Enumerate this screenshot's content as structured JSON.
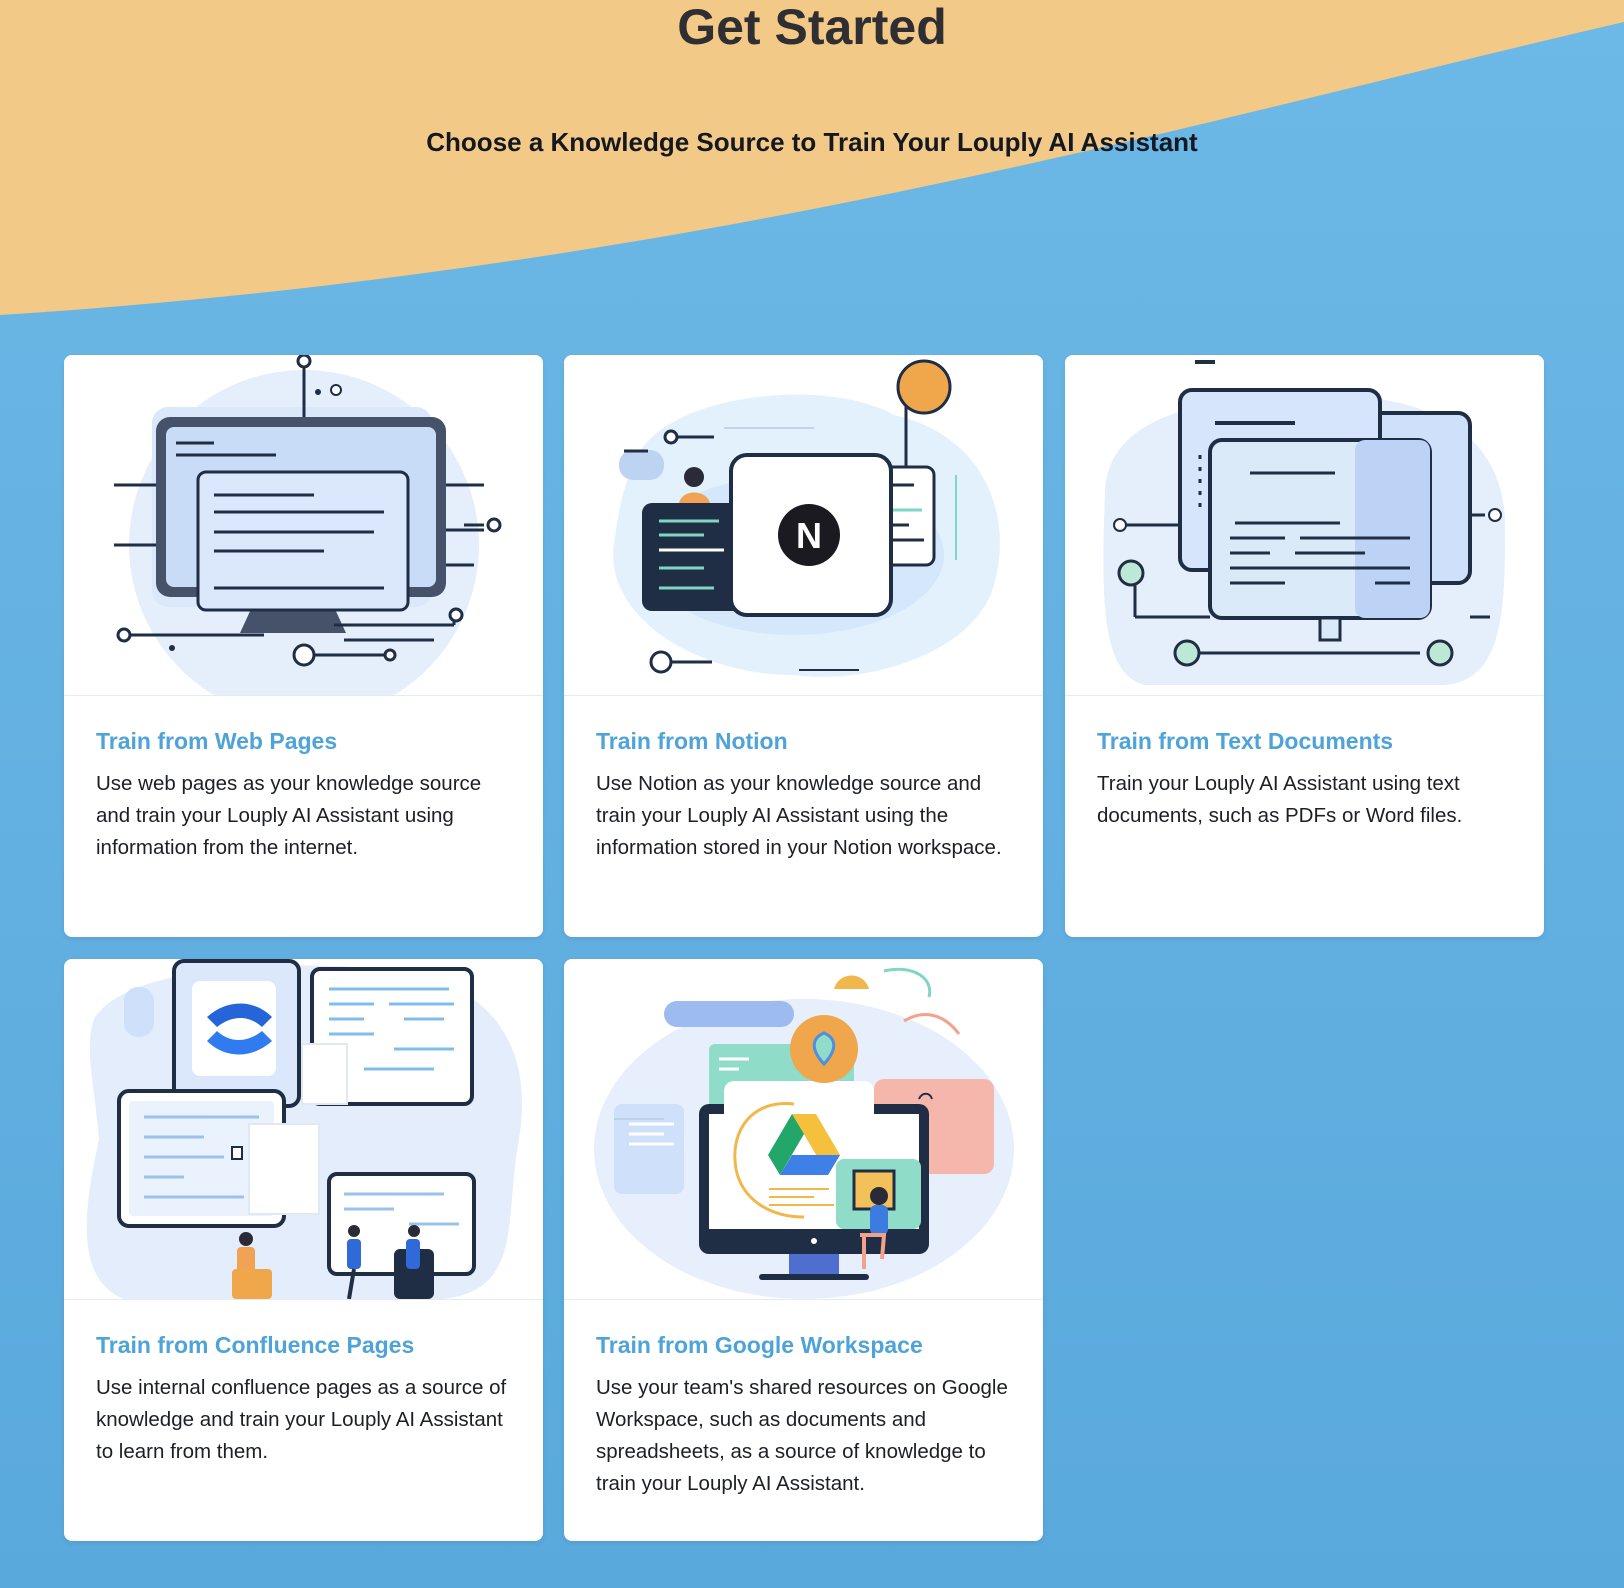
{
  "header": {
    "title": "Get Started",
    "subtitle": "Choose a Knowledge Source to Train Your Louply AI Assistant"
  },
  "cards": [
    {
      "title": "Train from Web Pages",
      "description": "Use web pages as your knowledge source and train your Louply AI Assistant using information from the internet.",
      "illustration": "monitor-web-pages-icon"
    },
    {
      "title": "Train from Notion",
      "description": "Use Notion as your knowledge source and train your Louply AI Assistant using the information stored in your Notion workspace.",
      "illustration": "notion-logo-icon",
      "logo_letter": "N"
    },
    {
      "title": "Train from Text Documents",
      "description": "Train your Louply AI Assistant using text documents, such as PDFs or Word files.",
      "illustration": "text-documents-icon"
    },
    {
      "title": "Train from Confluence Pages",
      "description": "Use internal confluence pages as a source of knowledge and train your Louply AI Assistant to learn from them.",
      "illustration": "confluence-logo-icon"
    },
    {
      "title": "Train from Google Workspace",
      "description": "Use your team's shared resources on Google Workspace, such as documents and spreadsheets, as a source of knowledge to train your Louply AI Assistant.",
      "illustration": "google-drive-logo-icon"
    }
  ],
  "colors": {
    "background_blue": "#5aa9dd",
    "wave_orange": "#f2c986",
    "card_title_blue": "#4ea3d8",
    "navy": "#1f2d45"
  }
}
